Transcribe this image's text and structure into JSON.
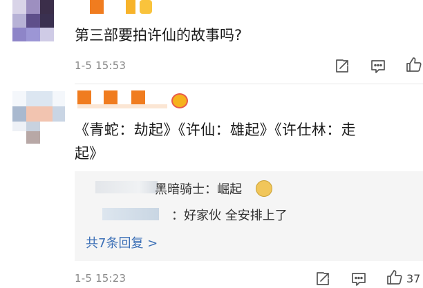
{
  "comments": [
    {
      "text": "第三部要拍许仙的故事吗?",
      "time": "1-5 15:53",
      "actions": {
        "share_icon": "share-icon",
        "comment_icon": "comment-icon",
        "like_icon": "thumbs-up-icon"
      }
    },
    {
      "text_line1": "《青蛇：劫起》《许仙：雄起》《许仕林：走",
      "text_line2": "起》",
      "time": "1-5 15:23",
      "like_count": "37",
      "replies": [
        {
          "text": "黑暗骑士：崛起",
          "emoji": "doge"
        },
        {
          "text": "：好家伙  全安排上了"
        }
      ],
      "more_replies": "共7条回复 >"
    }
  ],
  "colors": {
    "accent_orange": "#f07c1f",
    "link_blue": "#3b6fb6",
    "timestamp_gray": "#8a8a8a",
    "reply_bg": "#f5f5f5"
  }
}
